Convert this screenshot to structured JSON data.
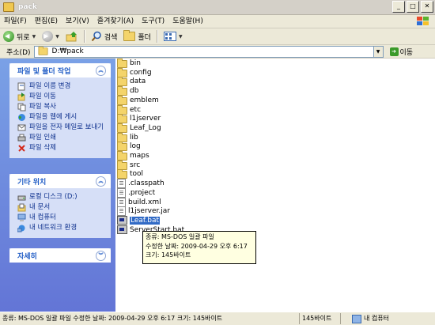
{
  "window": {
    "title": "pack"
  },
  "menu": [
    "파일(F)",
    "편집(E)",
    "보기(V)",
    "즐겨찾기(A)",
    "도구(T)",
    "도움말(H)"
  ],
  "toolbar": {
    "back_label": "뒤로",
    "search_label": "검색",
    "folders_label": "폴더"
  },
  "address": {
    "label": "주소(D)",
    "path": "D:₩pack",
    "go_label": "이동"
  },
  "left_panels": {
    "tasks": {
      "title": "파일 및 폴더 작업",
      "items": [
        {
          "label": "파일 이름 변경",
          "icon": "rename-icon"
        },
        {
          "label": "파일 이동",
          "icon": "move-icon"
        },
        {
          "label": "파일 복사",
          "icon": "copy-icon"
        },
        {
          "label": "파일을 웹에 게시",
          "icon": "globe-icon"
        },
        {
          "label": "파일을 전자 메일로 보내기",
          "icon": "email-icon"
        },
        {
          "label": "파일 인쇄",
          "icon": "printer-icon"
        },
        {
          "label": "파일 삭제",
          "icon": "delete-icon"
        }
      ]
    },
    "places": {
      "title": "기타 위치",
      "items": [
        {
          "label": "로컬 디스크 (D:)",
          "icon": "drive-icon"
        },
        {
          "label": "내 문서",
          "icon": "documents-icon"
        },
        {
          "label": "내 컴퓨터",
          "icon": "computer-icon"
        },
        {
          "label": "내 네트워크 환경",
          "icon": "network-icon"
        }
      ]
    },
    "details": {
      "title": "자세히"
    }
  },
  "files": [
    {
      "name": "bin",
      "type": "folder"
    },
    {
      "name": "config",
      "type": "folder"
    },
    {
      "name": "data",
      "type": "folder"
    },
    {
      "name": "db",
      "type": "folder"
    },
    {
      "name": "emblem",
      "type": "folder"
    },
    {
      "name": "etc",
      "type": "folder"
    },
    {
      "name": "l1jserver",
      "type": "folder"
    },
    {
      "name": "Leaf_Log",
      "type": "folder"
    },
    {
      "name": "lib",
      "type": "folder"
    },
    {
      "name": "log",
      "type": "folder"
    },
    {
      "name": "maps",
      "type": "folder"
    },
    {
      "name": "src",
      "type": "folder"
    },
    {
      "name": "tool",
      "type": "folder"
    },
    {
      "name": ".classpath",
      "type": "doc"
    },
    {
      "name": ".project",
      "type": "doc"
    },
    {
      "name": "build.xml",
      "type": "doc"
    },
    {
      "name": "l1jserver.jar",
      "type": "doc"
    },
    {
      "name": "Leaf.bat",
      "type": "bat",
      "selected": true
    },
    {
      "name": "ServerStart.bat",
      "type": "bat"
    }
  ],
  "tooltip": {
    "line1": "종류: MS-DOS 일괄 파일",
    "line2": "수정한 날짜: 2009-04-29 오후 6:17",
    "line3": "크기: 145바이트"
  },
  "status": {
    "text": "종류: MS-DOS 일괄 파일 수정한 날짜: 2009-04-29 오후 6:17 크기: 145바이트",
    "size": "145바이트",
    "location": "내 컴퓨터"
  }
}
